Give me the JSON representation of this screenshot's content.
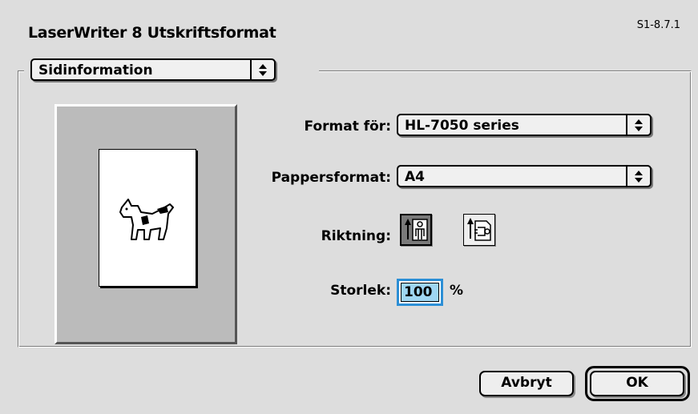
{
  "dialog": {
    "title": "LaserWriter 8 Utskriftsformat",
    "version": "S1-8.7.1"
  },
  "section_popup": {
    "value": "Sidinformation",
    "icon": "updown-arrows-icon"
  },
  "preview": {
    "icon": "clarus-dogcow-icon"
  },
  "format_for": {
    "label": "Format för:",
    "value": "HL-7050 series"
  },
  "paper_size": {
    "label": "Pappersformat:",
    "value": "A4"
  },
  "orientation": {
    "label": "Riktning:",
    "options": [
      {
        "name": "portrait",
        "icon": "portrait-orientation-icon",
        "selected": true
      },
      {
        "name": "landscape",
        "icon": "landscape-orientation-icon",
        "selected": false
      }
    ]
  },
  "scale": {
    "label": "Storlek:",
    "value": "100",
    "unit": "%"
  },
  "buttons": {
    "cancel": "Avbryt",
    "ok": "OK"
  },
  "colors": {
    "background": "#dddddd",
    "focus_ring": "#2c8fd6",
    "field_highlight": "#9fd6f2"
  }
}
